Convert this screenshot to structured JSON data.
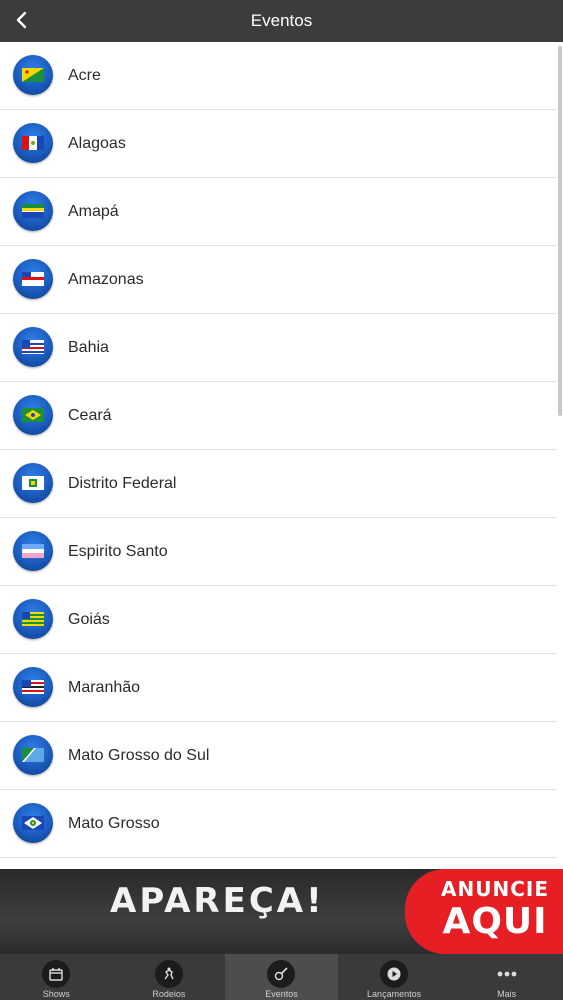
{
  "header": {
    "title": "Eventos"
  },
  "states": [
    {
      "label": "Acre"
    },
    {
      "label": "Alagoas"
    },
    {
      "label": "Amapá"
    },
    {
      "label": "Amazonas"
    },
    {
      "label": "Bahia"
    },
    {
      "label": "Ceará"
    },
    {
      "label": "Distrito Federal"
    },
    {
      "label": "Espirito Santo"
    },
    {
      "label": "Goiás"
    },
    {
      "label": "Maranhão"
    },
    {
      "label": "Mato Grosso do Sul"
    },
    {
      "label": "Mato Grosso"
    }
  ],
  "banner": {
    "main": "APAREÇA!",
    "cta_line1": "ANUNCIE",
    "cta_line2": "AQUI"
  },
  "tabs": [
    {
      "label": "Shows",
      "icon": "calendar-icon"
    },
    {
      "label": "Rodeios",
      "icon": "rodeo-icon"
    },
    {
      "label": "Eventos",
      "icon": "guitar-icon",
      "active": true
    },
    {
      "label": "Lançamentos",
      "icon": "play-icon"
    },
    {
      "label": "Mais",
      "icon": "more-icon"
    }
  ],
  "colors": {
    "topbar": "#3c3c3c",
    "flag_circle": "#1a5bbd",
    "banner_red": "#e61f25",
    "tabbar": "#3a3a3a"
  }
}
